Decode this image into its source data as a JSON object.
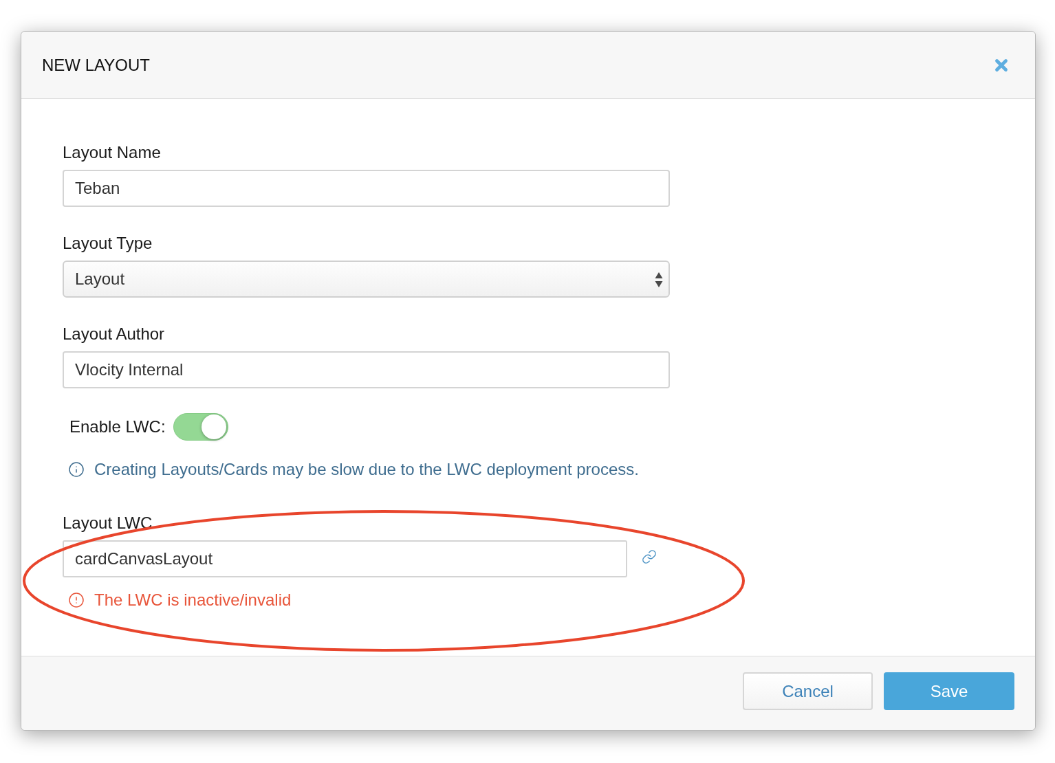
{
  "dialog": {
    "title": "NEW LAYOUT"
  },
  "fields": [
    {
      "kind": "text",
      "label": "Layout Name",
      "value": "Teban"
    },
    {
      "kind": "select",
      "label": "Layout Type",
      "value": "Layout"
    },
    {
      "kind": "text",
      "label": "Layout Author",
      "value": "Vlocity Internal"
    }
  ],
  "toggle": {
    "label": "Enable LWC:",
    "on": true
  },
  "info_message": "Creating Layouts/Cards may be slow due to the LWC deployment process.",
  "lwc_field": {
    "label": "Layout LWC",
    "value": "cardCanvasLayout",
    "error": "The LWC is inactive/invalid"
  },
  "annotation": {
    "kind": "ellipse"
  },
  "buttons": [
    {
      "kind": "secondary",
      "label": "Cancel"
    },
    {
      "kind": "primary",
      "label": "Save"
    }
  ]
}
